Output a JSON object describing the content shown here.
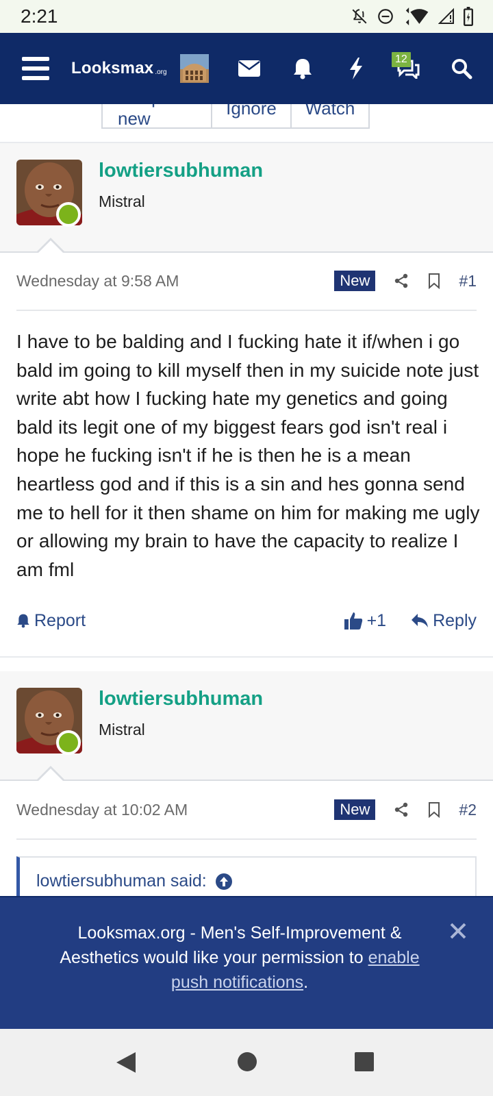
{
  "status_bar": {
    "time": "2:21"
  },
  "nav": {
    "logo_main": "Looksmax",
    "logo_suffix": ".org",
    "conversations_badge": "12",
    "icons": [
      "menu-icon",
      "mail-icon",
      "bell-icon",
      "bolt-icon",
      "chat-icon",
      "search-icon"
    ]
  },
  "thread_buttons": [
    "Jump to new",
    "Ignore",
    "Watch"
  ],
  "posts": [
    {
      "username": "lowtiersubhuman",
      "user_title": "Mistral",
      "date": "Wednesday at 9:58 AM",
      "badge": "New",
      "number": "#1",
      "body": "I have to be balding and I fucking hate it if/when i go bald im going to kill myself then in my suicide note just write abt how I fucking hate my genetics and going bald its legit one of my biggest fears god isn't real i hope he fucking isn't if he is then he is a mean heartless god and if this is a sin and hes gonna send me to hell for it then shame on him for making me ugly or allowing my brain to have the capacity to realize I am fml",
      "report_label": "Report",
      "reaction_count": "+1",
      "reply_label": "Reply"
    },
    {
      "username": "lowtiersubhuman",
      "user_title": "Mistral",
      "date": "Wednesday at 10:02 AM",
      "badge": "New",
      "number": "#2",
      "quote_author": "lowtiersubhuman said:"
    }
  ],
  "push_banner": {
    "text_before": "Looksmax.org - Men's Self-Improvement & Aesthetics would like your permission to ",
    "link_text": "enable push notifications",
    "text_after": "."
  },
  "colors": {
    "nav_bg": "#0f2a67",
    "username": "#14a085",
    "online": "#7cb31b",
    "badge_new": "#1f3473",
    "banner_bg": "#223d82"
  }
}
